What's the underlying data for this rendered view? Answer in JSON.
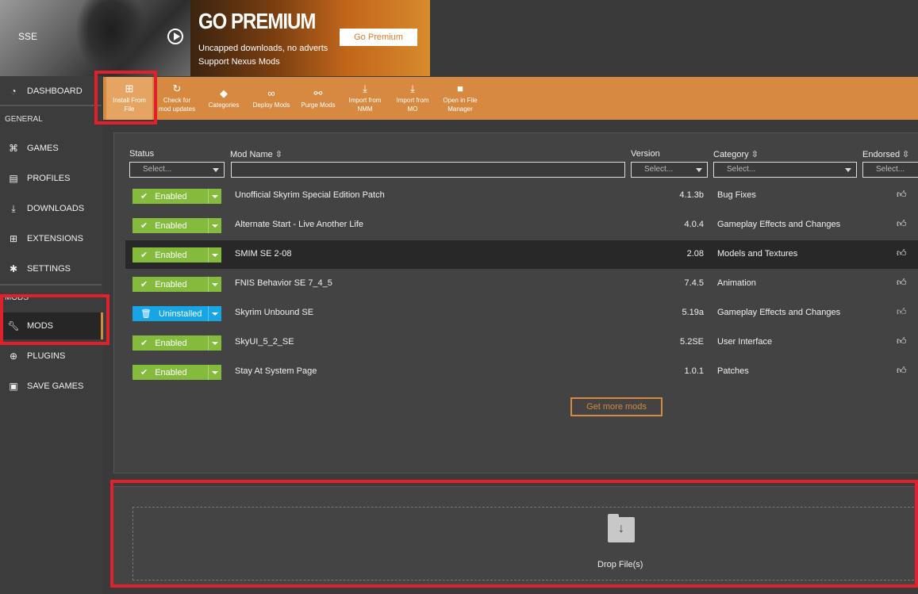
{
  "game": {
    "name": "SSE"
  },
  "premium": {
    "title": "GO PREMIUM",
    "line1": "Uncapped downloads, no adverts",
    "line2": "Support Nexus Mods",
    "button": "Go Premium"
  },
  "sidebar": {
    "dashboard": "DASHBOARD",
    "general_label": "GENERAL",
    "games": "GAMES",
    "profiles": "PROFILES",
    "downloads": "DOWNLOADS",
    "extensions": "EXTENSIONS",
    "settings": "SETTINGS",
    "mods_label": "MODS",
    "mods": "MODS",
    "plugins": "PLUGINS",
    "save_games": "SAVE GAMES"
  },
  "toolbar": {
    "install_from_file_1": "Install From",
    "install_from_file_2": "File",
    "check_updates_1": "Check for",
    "check_updates_2": "mod updates",
    "categories": "Categories",
    "deploy_mods": "Deploy Mods",
    "purge_mods": "Purge Mods",
    "import_nmm_1": "Import from",
    "import_nmm_2": "NMM",
    "import_mo_1": "Import from",
    "import_mo_2": "MO",
    "open_file_manager_1": "Open in File",
    "open_file_manager_2": "Manager"
  },
  "table": {
    "headers": {
      "status": "Status",
      "mod_name": "Mod Name",
      "version": "Version",
      "category": "Category",
      "endorsed": "Endorsed"
    },
    "filter_placeholder": "Select...",
    "rows": [
      {
        "status": "Enabled",
        "name": "Unofficial Skyrim Special Edition Patch",
        "version": "4.1.3b",
        "category": "Bug Fixes"
      },
      {
        "status": "Enabled",
        "name": "Alternate Start - Live Another Life",
        "version": "4.0.4",
        "category": "Gameplay Effects and Changes"
      },
      {
        "status": "Enabled",
        "name": "SMIM SE 2-08",
        "version": "2.08",
        "category": "Models and Textures"
      },
      {
        "status": "Enabled",
        "name": "FNIS Behavior SE 7_4_5",
        "version": "7.4.5",
        "category": "Animation"
      },
      {
        "status": "Uninstalled",
        "name": "Skyrim Unbound SE",
        "version": "5.19a",
        "category": "Gameplay Effects and Changes"
      },
      {
        "status": "Enabled",
        "name": "SkyUI_5_2_SE",
        "version": "5.2SE",
        "category": "User Interface"
      },
      {
        "status": "Enabled",
        "name": "Stay At System Page",
        "version": "1.0.1",
        "category": "Patches"
      }
    ],
    "get_more_mods": "Get more mods"
  },
  "drop_zone": {
    "label": "Drop File(s)"
  },
  "colors": {
    "accent": "#d6893f",
    "enabled": "#84bb3c",
    "uninstalled": "#16a6e6",
    "highlight": "#e0202a"
  }
}
